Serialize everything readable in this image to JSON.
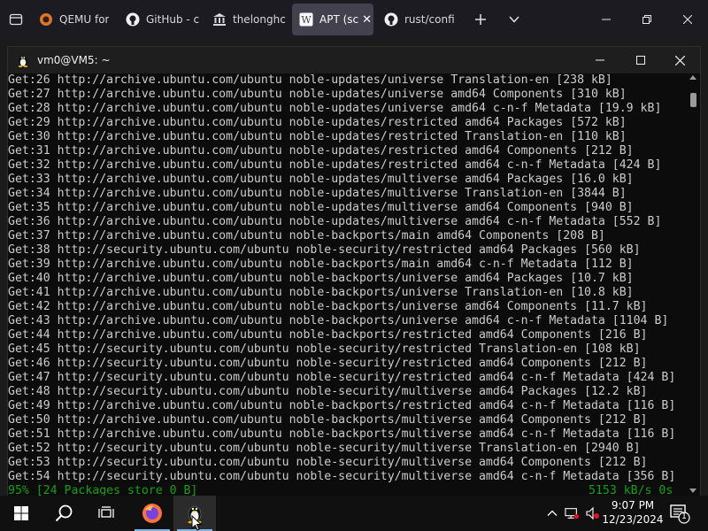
{
  "browser": {
    "tabs": [
      {
        "label": "QEMU for",
        "icon": "qemu-icon"
      },
      {
        "label": "GitHub - c",
        "icon": "github-icon"
      },
      {
        "label": "thelonghc",
        "icon": "bank-icon"
      },
      {
        "label": "APT (sc",
        "icon": "wikipedia-icon",
        "active": true
      },
      {
        "label": "rust/confi",
        "icon": "github-icon"
      }
    ]
  },
  "terminal": {
    "title": "vm0@VM5: ~",
    "lines": [
      "Get:26 http://archive.ubuntu.com/ubuntu noble-updates/universe Translation-en [238 kB]",
      "Get:27 http://archive.ubuntu.com/ubuntu noble-updates/universe amd64 Components [310 kB]",
      "Get:28 http://archive.ubuntu.com/ubuntu noble-updates/universe amd64 c-n-f Metadata [19.9 kB]",
      "Get:29 http://archive.ubuntu.com/ubuntu noble-updates/restricted amd64 Packages [572 kB]",
      "Get:30 http://archive.ubuntu.com/ubuntu noble-updates/restricted Translation-en [110 kB]",
      "Get:31 http://archive.ubuntu.com/ubuntu noble-updates/restricted amd64 Components [212 B]",
      "Get:32 http://archive.ubuntu.com/ubuntu noble-updates/restricted amd64 c-n-f Metadata [424 B]",
      "Get:33 http://archive.ubuntu.com/ubuntu noble-updates/multiverse amd64 Packages [16.0 kB]",
      "Get:34 http://archive.ubuntu.com/ubuntu noble-updates/multiverse Translation-en [3844 B]",
      "Get:35 http://archive.ubuntu.com/ubuntu noble-updates/multiverse amd64 Components [940 B]",
      "Get:36 http://archive.ubuntu.com/ubuntu noble-updates/multiverse amd64 c-n-f Metadata [552 B]",
      "Get:37 http://archive.ubuntu.com/ubuntu noble-backports/main amd64 Components [208 B]",
      "Get:38 http://security.ubuntu.com/ubuntu noble-security/restricted amd64 Packages [560 kB]",
      "Get:39 http://archive.ubuntu.com/ubuntu noble-backports/main amd64 c-n-f Metadata [112 B]",
      "Get:40 http://archive.ubuntu.com/ubuntu noble-backports/universe amd64 Packages [10.7 kB]",
      "Get:41 http://archive.ubuntu.com/ubuntu noble-backports/universe Translation-en [10.8 kB]",
      "Get:42 http://archive.ubuntu.com/ubuntu noble-backports/universe amd64 Components [11.7 kB]",
      "Get:43 http://archive.ubuntu.com/ubuntu noble-backports/universe amd64 c-n-f Metadata [1104 B]",
      "Get:44 http://archive.ubuntu.com/ubuntu noble-backports/restricted amd64 Components [216 B]",
      "Get:45 http://security.ubuntu.com/ubuntu noble-security/restricted Translation-en [108 kB]",
      "Get:46 http://security.ubuntu.com/ubuntu noble-security/restricted amd64 Components [212 B]",
      "Get:47 http://security.ubuntu.com/ubuntu noble-security/restricted amd64 c-n-f Metadata [424 B]",
      "Get:48 http://security.ubuntu.com/ubuntu noble-security/multiverse amd64 Packages [12.2 kB]",
      "Get:49 http://archive.ubuntu.com/ubuntu noble-backports/restricted amd64 c-n-f Metadata [116 B]",
      "Get:50 http://archive.ubuntu.com/ubuntu noble-backports/multiverse amd64 Components [212 B]",
      "Get:51 http://archive.ubuntu.com/ubuntu noble-backports/multiverse amd64 c-n-f Metadata [116 B]",
      "Get:52 http://security.ubuntu.com/ubuntu noble-security/multiverse Translation-en [2940 B]",
      "Get:53 http://security.ubuntu.com/ubuntu noble-security/multiverse amd64 Components [212 B]",
      "Get:54 http://security.ubuntu.com/ubuntu noble-security/multiverse amd64 c-n-f Metadata [356 B]"
    ],
    "status_left": "95% [24 Packages store 0 B]",
    "status_right": "5153 kB/s 0s",
    "status_color": "#13a10e"
  },
  "taskbar": {
    "apps": [
      "start-icon",
      "search-icon",
      "task-view-icon",
      "firefox-icon",
      "terminal-linux-icon"
    ],
    "clock_time": "9:07 PM",
    "clock_date": "12/23/2024",
    "notification_count": "1"
  }
}
